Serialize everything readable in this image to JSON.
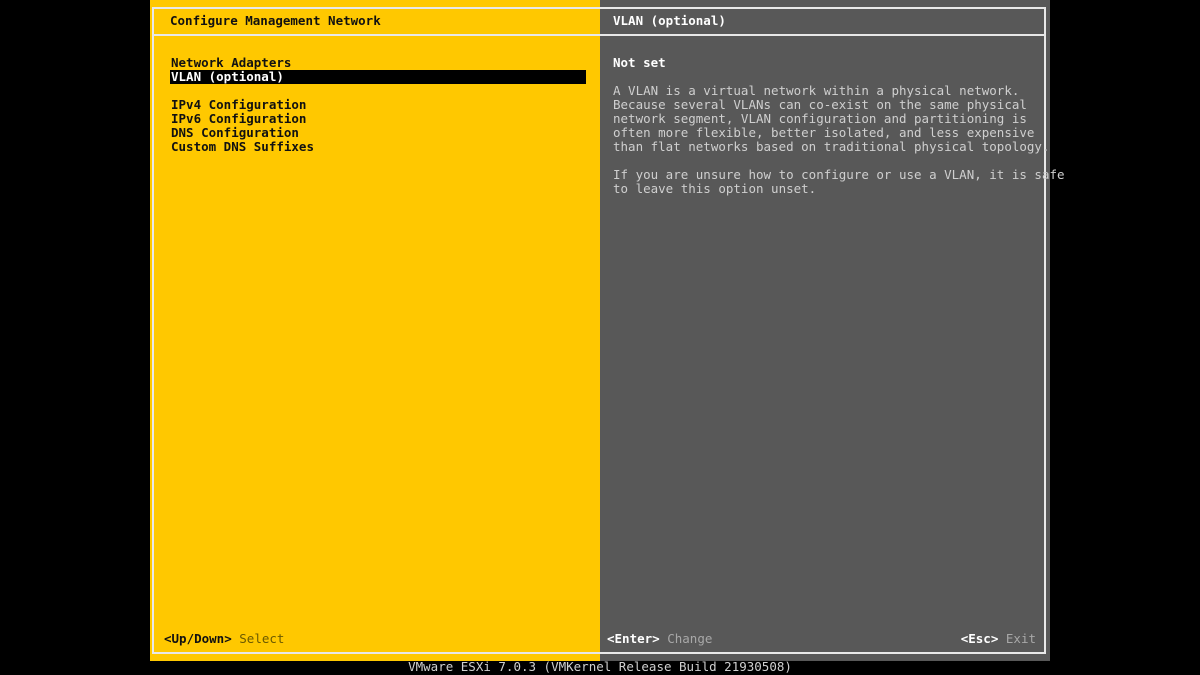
{
  "left_panel": {
    "title": "Configure Management Network",
    "menu": [
      {
        "label": "Network Adapters",
        "selected": false
      },
      {
        "label": "VLAN (optional)",
        "selected": true
      },
      {
        "label": "IPv4 Configuration",
        "selected": false
      },
      {
        "label": "IPv6 Configuration",
        "selected": false
      },
      {
        "label": "DNS Configuration",
        "selected": false
      },
      {
        "label": "Custom DNS Suffixes",
        "selected": false
      }
    ]
  },
  "right_panel": {
    "title": "VLAN (optional)",
    "status": "Not set",
    "paragraph1": "A VLAN is a virtual network within a physical network.\nBecause several VLANs can co-exist on the same physical\nnetwork segment, VLAN configuration and partitioning is\noften more flexible, better isolated, and less expensive\nthan flat networks based on traditional physical topology.",
    "paragraph2": "If you are unsure how to configure or use a VLAN, it is safe\nto leave this option unset."
  },
  "footer": {
    "left_key": "<Up/Down>",
    "left_action": "Select",
    "mid_key": "<Enter>",
    "mid_action": "Change",
    "right_key": "<Esc>",
    "right_action": "Exit"
  },
  "status_bar": "VMware ESXi 7.0.3 (VMKernel Release Build 21930508)",
  "colors": {
    "left_bg": "#FFC800",
    "right_bg": "#585858",
    "selection_bg": "#000000"
  }
}
